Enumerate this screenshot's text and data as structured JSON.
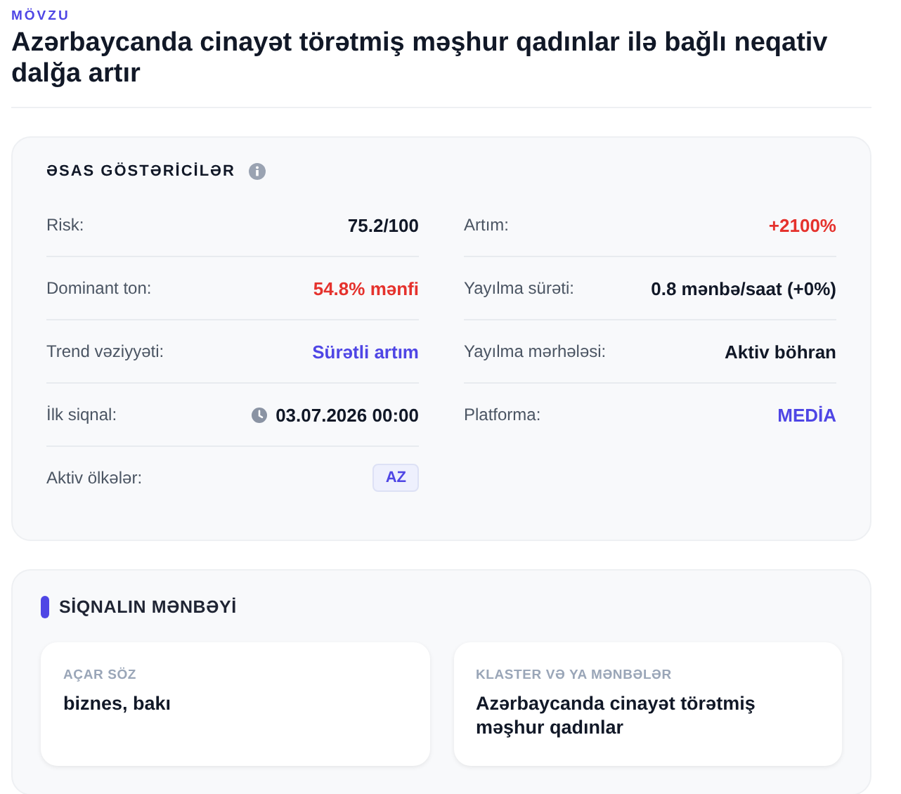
{
  "topic_label": "MÖVZU",
  "title": "Azərbaycanda cinayət törətmiş məşhur qadınlar ilə bağlı neqativ dalğa artır",
  "metrics": {
    "heading": "ƏSAS GÖSTƏRİCİLƏR",
    "left": [
      {
        "label": "Risk:",
        "value": "75.2/100",
        "kind": "text",
        "color": "#111827"
      },
      {
        "label": "Dominant ton:",
        "value": "54.8% mənfi",
        "kind": "text",
        "color": "#e5322d"
      },
      {
        "label": "Trend vəziyyəti:",
        "value": "Sürətli artım",
        "kind": "text",
        "color": "#4f46e5"
      },
      {
        "label": "İlk siqnal:",
        "value": "03.07.2026 00:00",
        "kind": "clock",
        "color": "#111827"
      },
      {
        "label": "Aktiv ölkələr:",
        "value": "AZ",
        "kind": "badge",
        "color": "#4f46e5"
      }
    ],
    "right": [
      {
        "label": "Artım:",
        "value": "+2100%",
        "kind": "text",
        "color": "#e5322d"
      },
      {
        "label": "Yayılma sürəti:",
        "value": "0.8 mənbə/saat (+0%)",
        "kind": "text",
        "color": "#111827"
      },
      {
        "label": "Yayılma mərhələsi:",
        "value": "Aktiv böhran",
        "kind": "text",
        "color": "#111827"
      },
      {
        "label": "Platforma:",
        "value": "MEDİA",
        "kind": "text",
        "color": "#4f46e5"
      }
    ]
  },
  "source": {
    "heading": "SİQNALIN MƏNBƏYİ",
    "cards": [
      {
        "label": "AÇAR SÖZ",
        "value": "biznes, bakı"
      },
      {
        "label": "KLASTER VƏ YA MƏNBƏLƏR",
        "value": "Azərbaycanda cinayət törətmiş məşhur qadınlar"
      }
    ]
  }
}
